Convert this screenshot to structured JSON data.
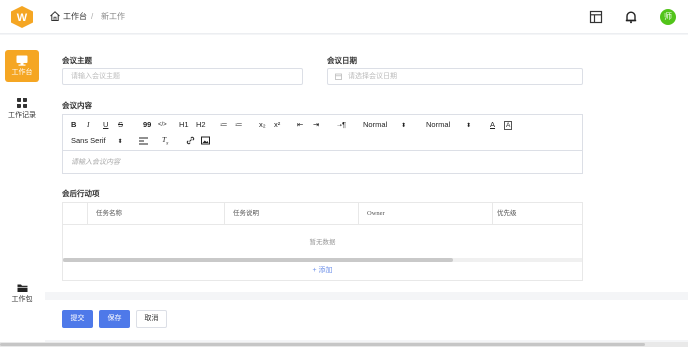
{
  "breadcrumb": {
    "home": "工作台",
    "separator": "/",
    "current": "新工作"
  },
  "header_icons": [
    "layout-icon",
    "bell-icon"
  ],
  "avatar": {
    "text": "师",
    "color": "#52c41a"
  },
  "sidebar": {
    "items": [
      {
        "label": "工作台",
        "icon": "monitor-icon",
        "active": true
      },
      {
        "label": "工作记录",
        "icon": "grid-icon",
        "active": false
      },
      {
        "label": "工作包",
        "icon": "folder-icon",
        "active": false
      }
    ]
  },
  "form": {
    "topic": {
      "label": "会议主题",
      "placeholder": "请输入会议主题"
    },
    "date": {
      "label": "会议日期",
      "placeholder": "请选择会议日期"
    },
    "content": {
      "label": "会议内容",
      "placeholder": "请输入会议内容"
    },
    "actions_label": "会后行动项"
  },
  "editor_toolbar": {
    "header_select": "Normal",
    "size_select": "Normal",
    "font_select": "Sans Serif",
    "buttons": [
      "B",
      "I",
      "U",
      "S",
      "99",
      "</>",
      "H1",
      "H2",
      "≔",
      "≔",
      "x₂",
      "x²",
      "⇤",
      "⇥",
      "¶",
      "A",
      "A"
    ]
  },
  "table": {
    "columns": [
      "任务名称",
      "任务说明",
      "Owner",
      "优先级"
    ],
    "empty_text": "暂无数据",
    "add_label": "+ 添加"
  },
  "buttons": {
    "submit": "提交",
    "save": "保存",
    "cancel": "取消"
  },
  "colors": {
    "accent": "#f5a623",
    "primary": "#4e79e9",
    "avatar": "#52c41a"
  }
}
